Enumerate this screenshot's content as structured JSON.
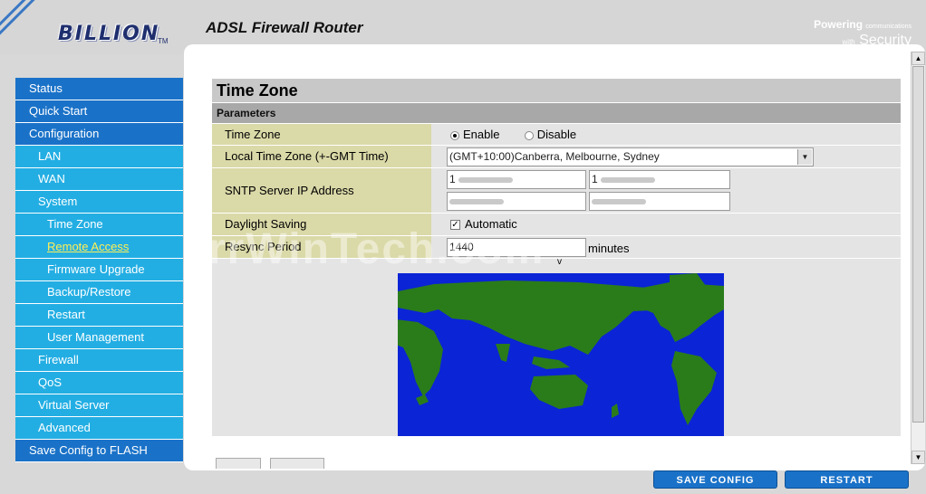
{
  "header": {
    "brand": "BILLION",
    "trademark": "TM",
    "product_title": "ADSL Firewall Router",
    "tagline_line1": "Powering",
    "tagline_line1_small": "communications",
    "tagline_line2_small": "with",
    "tagline_line2": "Security"
  },
  "sidebar": {
    "items": [
      {
        "label": "Status"
      },
      {
        "label": "Quick Start"
      },
      {
        "label": "Configuration"
      },
      {
        "label": "LAN"
      },
      {
        "label": "WAN"
      },
      {
        "label": "System"
      },
      {
        "label": "Time Zone"
      },
      {
        "label": "Remote Access"
      },
      {
        "label": "Firmware Upgrade"
      },
      {
        "label": "Backup/Restore"
      },
      {
        "label": "Restart"
      },
      {
        "label": "User Management"
      },
      {
        "label": "Firewall"
      },
      {
        "label": "QoS"
      },
      {
        "label": "Virtual Server"
      },
      {
        "label": "Advanced"
      },
      {
        "label": "Save Config to FLASH"
      }
    ]
  },
  "page": {
    "title": "Time Zone",
    "section": "Parameters",
    "time_zone_label": "Time Zone",
    "enable_label": "Enable",
    "disable_label": "Disable",
    "local_tz_label": "Local Time Zone (+-GMT Time)",
    "local_tz_value": "(GMT+10:00)Canberra, Melbourne, Sydney",
    "sntp_label": "SNTP Server IP Address",
    "sntp1": "1",
    "sntp2": "1",
    "daylight_label": "Daylight Saving",
    "automatic_label": "Automatic",
    "resync_label": "Resync Period",
    "resync_value": "1440",
    "minutes_label": "minutes",
    "map_marker": "v"
  },
  "watermark": "rrWinTech.com",
  "buttons": {
    "save_config": "SAVE CONFIG",
    "restart": "RESTART"
  },
  "colors": {
    "nav_main": "#1a72c8",
    "nav_sub": "#23aee3",
    "map_ocean": "#0b24d6",
    "map_land": "#2a7c1a",
    "label_bg": "#dad9a8"
  }
}
